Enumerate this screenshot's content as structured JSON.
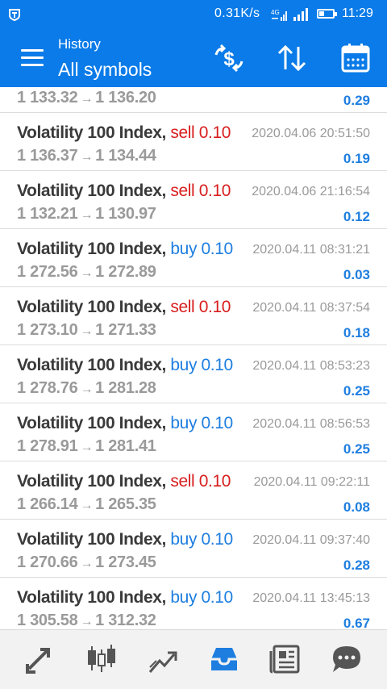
{
  "toolbar": {
    "subtitle": "History",
    "title": "All symbols",
    "icons": [
      "menu-icon",
      "dollar-exchange-icon",
      "sort-icon",
      "calendar-icon"
    ]
  },
  "status": {
    "speed": "0.31K/s",
    "time": "11:29"
  },
  "partial_row": {
    "prices_open": "1 133.32",
    "prices_close": "1 136.20",
    "profit": "0.29"
  },
  "deals": [
    {
      "symbol": "Volatility 100 Index,",
      "side": "sell",
      "volume": "0.10",
      "time": "2020.04.06 20:51:50",
      "open": "1 136.37",
      "close": "1 134.44",
      "profit": "0.19"
    },
    {
      "symbol": "Volatility 100 Index,",
      "side": "sell",
      "volume": "0.10",
      "time": "2020.04.06 21:16:54",
      "open": "1 132.21",
      "close": "1 130.97",
      "profit": "0.12"
    },
    {
      "symbol": "Volatility 100 Index,",
      "side": "buy",
      "volume": "0.10",
      "time": "2020.04.11 08:31:21",
      "open": "1 272.56",
      "close": "1 272.89",
      "profit": "0.03"
    },
    {
      "symbol": "Volatility 100 Index,",
      "side": "sell",
      "volume": "0.10",
      "time": "2020.04.11 08:37:54",
      "open": "1 273.10",
      "close": "1 271.33",
      "profit": "0.18"
    },
    {
      "symbol": "Volatility 100 Index,",
      "side": "buy",
      "volume": "0.10",
      "time": "2020.04.11 08:53:23",
      "open": "1 278.76",
      "close": "1 281.28",
      "profit": "0.25"
    },
    {
      "symbol": "Volatility 100 Index,",
      "side": "buy",
      "volume": "0.10",
      "time": "2020.04.11 08:56:53",
      "open": "1 278.91",
      "close": "1 281.41",
      "profit": "0.25"
    },
    {
      "symbol": "Volatility 100 Index,",
      "side": "sell",
      "volume": "0.10",
      "time": "2020.04.11 09:22:11",
      "open": "1 266.14",
      "close": "1 265.35",
      "profit": "0.08"
    },
    {
      "symbol": "Volatility 100 Index,",
      "side": "buy",
      "volume": "0.10",
      "time": "2020.04.11 09:37:40",
      "open": "1 270.66",
      "close": "1 273.45",
      "profit": "0.28"
    },
    {
      "symbol": "Volatility 100 Index,",
      "side": "buy",
      "volume": "0.10",
      "time": "2020.04.11 13:45:13",
      "open": "1 305.58",
      "close": "1 312.32",
      "profit": "0.67"
    }
  ],
  "arrow_glyph": "→",
  "bottom_nav": [
    "quotes-icon",
    "chart-icon",
    "trade-icon",
    "history-icon",
    "news-icon",
    "chat-icon"
  ],
  "colors": {
    "primary": "#0a7be8",
    "sell": "#d81e1e",
    "buy": "#1e7ee0",
    "muted": "#9a9a9a"
  }
}
